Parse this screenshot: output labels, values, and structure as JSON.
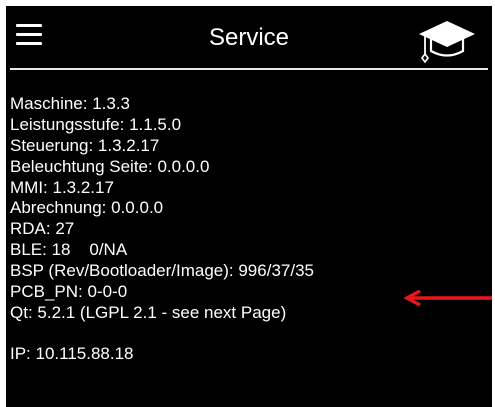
{
  "header": {
    "title": "Service",
    "menu_icon": "hamburger-menu-icon",
    "info_icon": "graduation-cap-icon"
  },
  "info_lines": [
    "Maschine: 1.3.3",
    "Leistungsstufe: 1.1.5.0",
    "Steuerung: 1.3.2.17",
    "Beleuchtung Seite: 0.0.0.0",
    "MMI: 1.3.2.17",
    "Abrechnung: 0.0.0.0",
    "RDA: 27",
    "BLE: 18    0/NA",
    "BSP (Rev/Bootloader/Image): 996/37/35",
    "PCB_PN: 0-0-0",
    "Qt: 5.2.1 (LGPL 2.1 - see next Page)",
    "IP: 10.115.88.18"
  ],
  "annotation": {
    "type": "red-arrow-icon",
    "color": "#e8161d",
    "points_to": "BSP (Rev/Bootloader/Image): 996/37/35"
  },
  "colors": {
    "screen_background": "#000000",
    "text": "#ffffff",
    "divider": "#e8e8e8",
    "annotation": "#e8161d"
  }
}
